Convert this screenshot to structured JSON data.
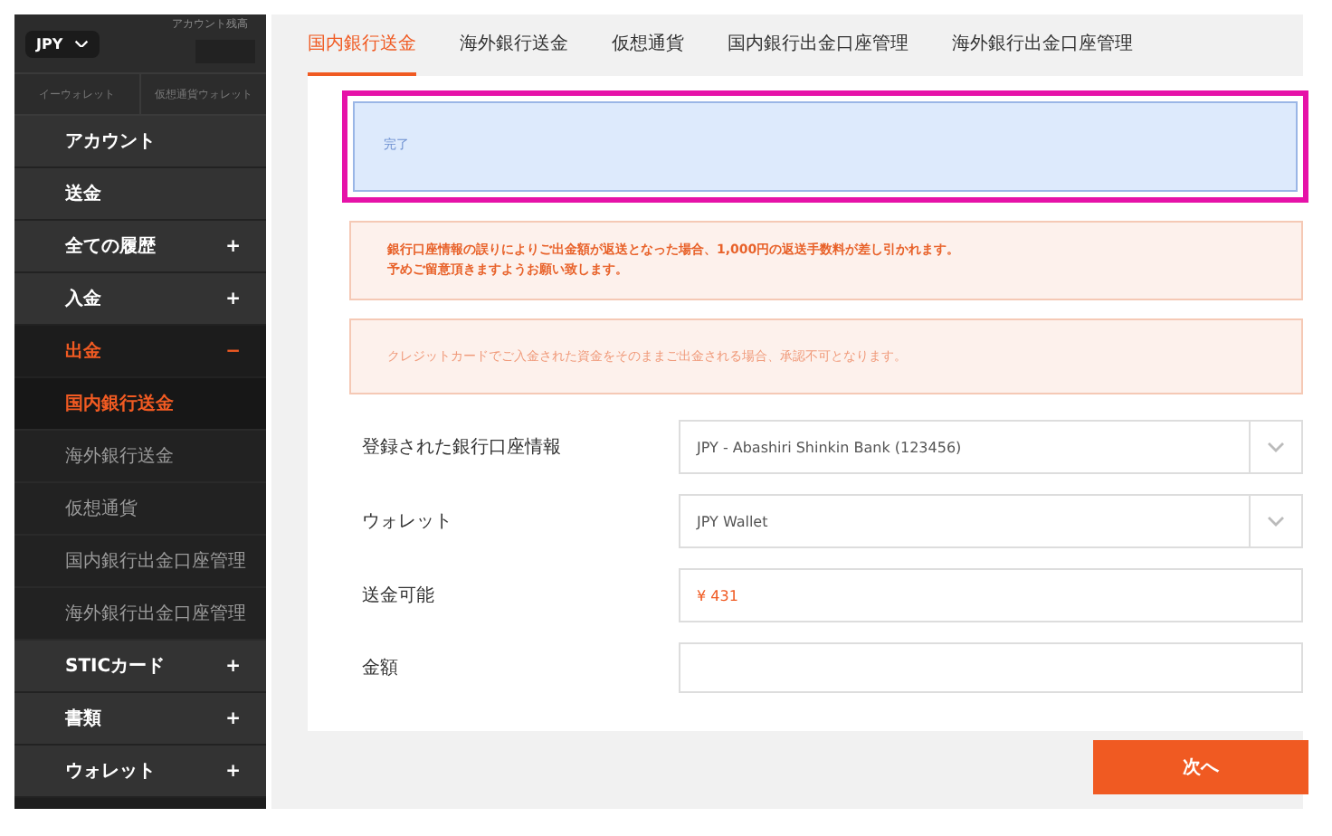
{
  "sidebar": {
    "currency": "JPY",
    "balance_label": "アカウント残高",
    "wallet_tabs": [
      "イーウォレット",
      "仮想通貨ウォレット"
    ],
    "menu": [
      {
        "label": "アカウント"
      },
      {
        "label": "送金"
      },
      {
        "label": "全ての履歴",
        "toggle": "+",
        "expanded": false
      },
      {
        "label": "入金",
        "toggle": "+",
        "expanded": false
      },
      {
        "label": "出金",
        "toggle": "−",
        "expanded": true,
        "children": [
          {
            "label": "国内銀行送金",
            "selected": true
          },
          {
            "label": "海外銀行送金",
            "selected": false
          },
          {
            "label": "仮想通貨",
            "selected": false
          },
          {
            "label": "国内銀行出金口座管理",
            "selected": false
          },
          {
            "label": "海外銀行出金口座管理",
            "selected": false
          }
        ]
      },
      {
        "label": "STICカード",
        "toggle": "+",
        "expanded": false
      },
      {
        "label": "書類",
        "toggle": "+",
        "expanded": false
      },
      {
        "label": "ウォレット",
        "toggle": "+",
        "expanded": false
      }
    ]
  },
  "tabs": [
    {
      "label": "国内銀行送金",
      "selected": true
    },
    {
      "label": "海外銀行送金",
      "selected": false
    },
    {
      "label": "仮想通貨",
      "selected": false
    },
    {
      "label": "国内銀行出金口座管理",
      "selected": false
    },
    {
      "label": "海外銀行出金口座管理",
      "selected": false
    }
  ],
  "alerts": [
    {
      "kind": "info",
      "lines": [
        "完了"
      ],
      "highlighted": true
    },
    {
      "kind": "warning",
      "lines": [
        "銀行口座情報の誤りによりご出金額が返送となった場合、1,000円の返送手数料が差し引かれます。",
        "予めご留意頂きますようお願い致します。"
      ],
      "highlighted": false
    },
    {
      "kind": "notice",
      "lines": [
        "クレジットカードでご入金された資金をそのままご出金される場合、承認不可となります。"
      ],
      "highlighted": false
    }
  ],
  "form": [
    {
      "label": "登録された銀行口座情報",
      "kind": "select",
      "value": "JPY - Abashiri Shinkin Bank (123456)"
    },
    {
      "label": "ウォレット",
      "kind": "select",
      "value": "JPY Wallet"
    },
    {
      "label": "送金可能",
      "kind": "amount",
      "value": "¥ 431"
    },
    {
      "label": "金額",
      "kind": "input"
    }
  ],
  "next_button": "次へ"
}
